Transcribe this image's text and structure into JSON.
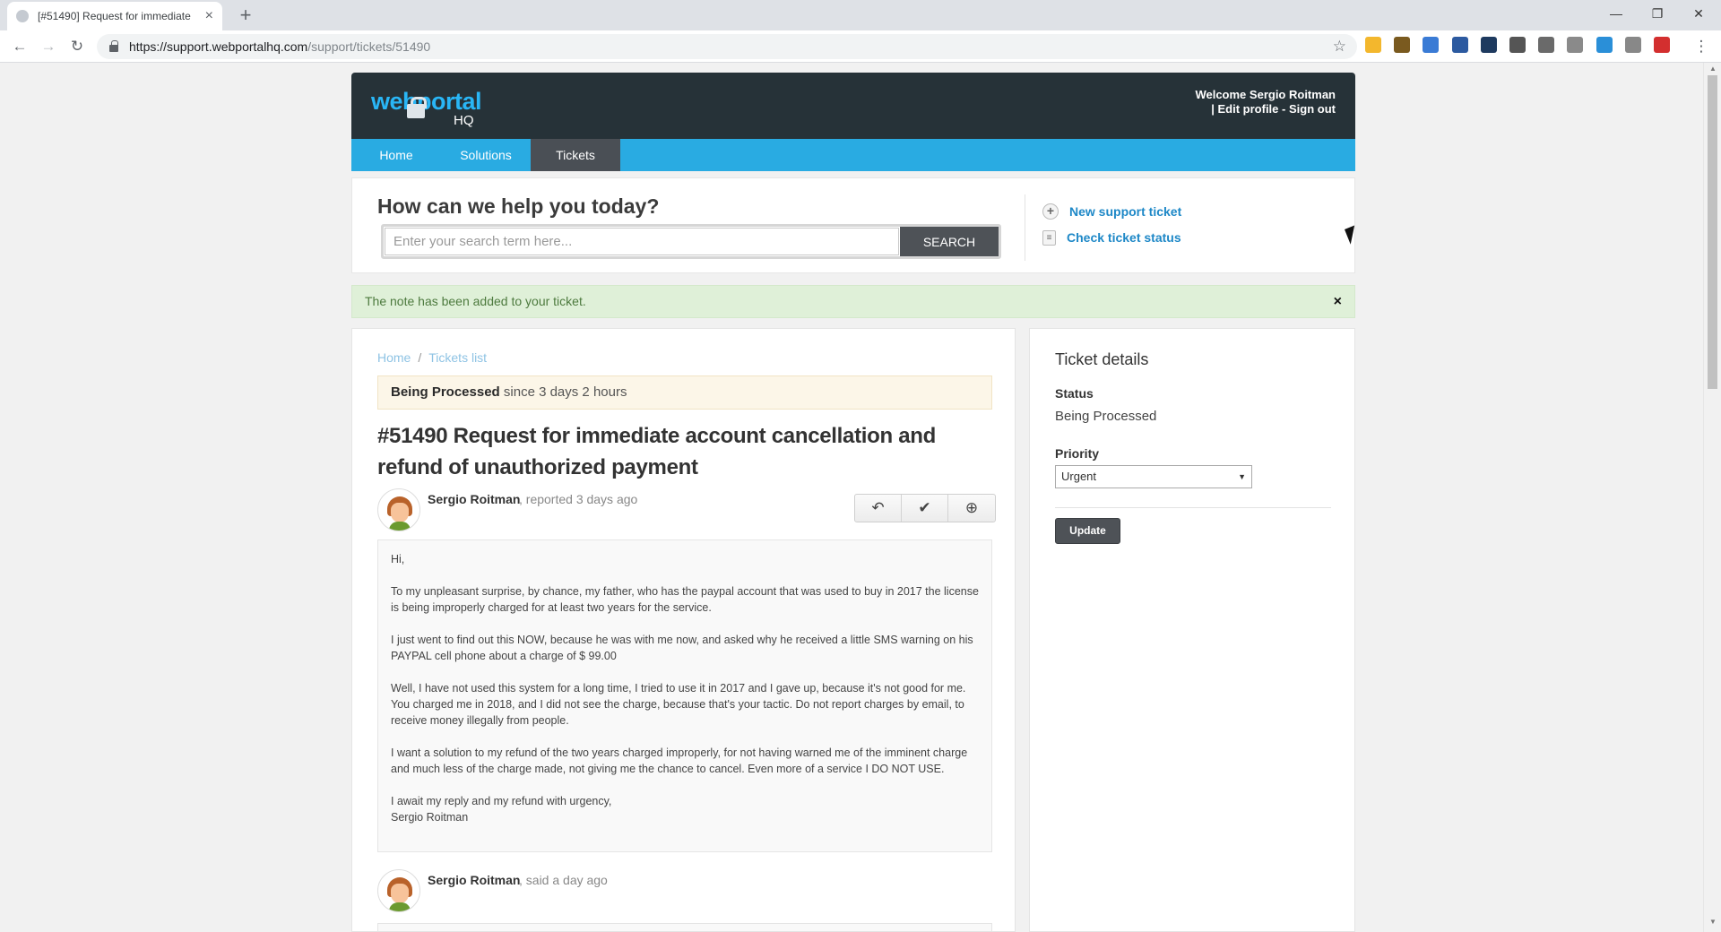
{
  "browser": {
    "tab_title": "[#51490] Request for immediate",
    "url_host": "https://support.webportalhq.com",
    "url_path": "/support/tickets/51490",
    "window_controls": {
      "minimize": "—",
      "restore": "❐",
      "close": "✕"
    },
    "extension_colors": [
      "#f3b72d",
      "#7a5a1f",
      "#3a7bd5",
      "#2c5aa0",
      "#1e3a5f",
      "#555555",
      "#6a6a6a",
      "#8a8a8a",
      "#2a8fd8",
      "#888888",
      "#d32f2f"
    ]
  },
  "header": {
    "logo_web": "webportal",
    "logo_hq": "HQ",
    "welcome_prefix": "Welcome",
    "user_name": "Sergio Roitman",
    "edit_profile": "Edit profile",
    "sign_out": "Sign out",
    "separator": "|",
    "dash": "-"
  },
  "nav": {
    "items": [
      {
        "label": "Home",
        "active": false
      },
      {
        "label": "Solutions",
        "active": false
      },
      {
        "label": "Tickets",
        "active": true
      }
    ]
  },
  "search": {
    "heading": "How can we help you today?",
    "placeholder": "Enter your search term here...",
    "button": "SEARCH",
    "new_ticket": "New support ticket",
    "check_status": "Check ticket status"
  },
  "alert": {
    "message": "The note has been added to your ticket.",
    "close": "×"
  },
  "ticket": {
    "breadcrumb": {
      "home": "Home",
      "sep": "/",
      "list": "Tickets list"
    },
    "status_bold": "Being Processed",
    "status_since": "since 3 days 2 hours",
    "title": "#51490 Request for immediate account cancellation and refund of unauthorized payment",
    "author": "Sergio Roitman",
    "reported": ", reported 3 days ago",
    "message": [
      "Hi,",
      "To my unpleasant surprise, by chance, my father, who has the paypal account that was used to buy in 2017 the license is being improperly charged for at least two years for the service.",
      "I just went to find out this NOW, because he was with me now, and asked why he received a little SMS warning on his PAYPAL cell phone about a charge of $ 99.00",
      "Well, I have not used this system for a long time, I tried to use it in 2017 and I gave up, because it's not good for me. You charged me in 2018, and I did not see the charge, because that's your tactic. Do not report charges by email, to receive money illegally from people.",
      "I want a solution to my refund of the two years charged improperly, for not having warned me of the imminent charge and much less of the charge made, not giving me the chance to cancel. Even more of a service I DO NOT USE.",
      "I await my reply and my refund with urgency,",
      "Sergio Roitman"
    ],
    "reply_author": "Sergio Roitman",
    "reply_meta": ", said a day ago"
  },
  "details": {
    "title": "Ticket details",
    "status_label": "Status",
    "status_value": "Being Processed",
    "priority_label": "Priority",
    "priority_value": "Urgent",
    "update_button": "Update"
  }
}
